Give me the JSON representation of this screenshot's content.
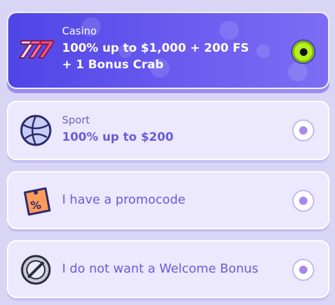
{
  "options": [
    {
      "category": "Casino",
      "title_line1": "100% up to $1,000 + 200 FS",
      "title_line2": "+ 1 Bonus Crab",
      "icon": "slot-777-icon",
      "selected": true
    },
    {
      "category": "Sport",
      "title": "100% up to $200",
      "icon": "basketball-icon",
      "selected": false
    },
    {
      "label": "I have a promocode",
      "icon": "promo-tag-icon",
      "selected": false
    },
    {
      "label": "I do not want a Welcome Bonus",
      "icon": "no-bonus-icon",
      "selected": false
    }
  ],
  "colors": {
    "selected_bg": "#5a4ee9",
    "radio_selected": "#b6ef1d",
    "radio_dot": "#a888f0",
    "text_purple": "#6a5cd8"
  }
}
